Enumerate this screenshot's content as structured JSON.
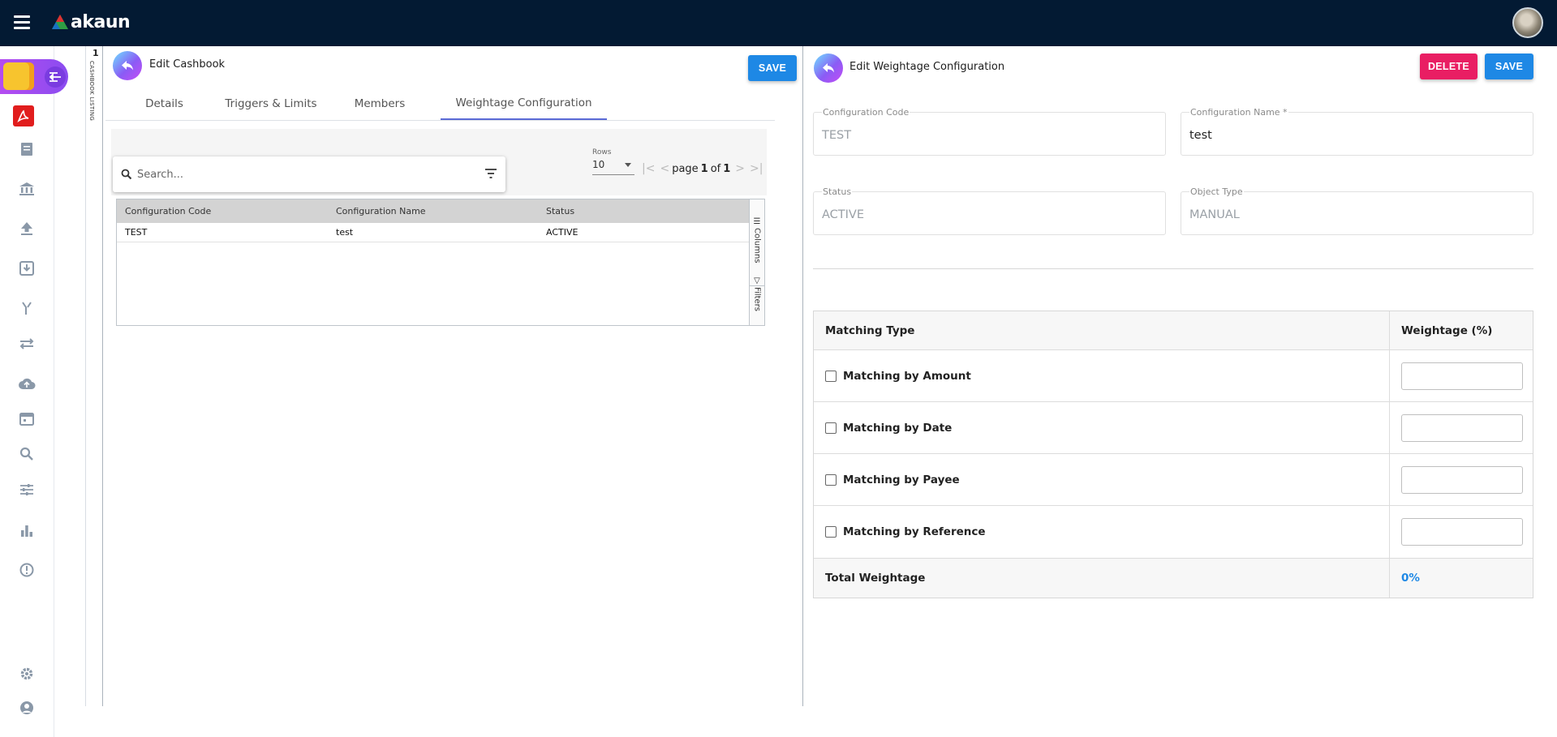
{
  "app": {
    "logo_text": "akaun"
  },
  "sidebar": {
    "icons": [
      "wallet-icon",
      "menu-collapse-icon",
      "acrobat-icon",
      "ledger-icon",
      "bank-icon",
      "upload-icon",
      "download-icon",
      "split-icon",
      "transfer-icon",
      "cloud-upload-icon",
      "calendar-icon",
      "search-icon",
      "sliders-icon",
      "bar-chart-icon",
      "alert-icon",
      "gear-icon",
      "user-icon"
    ]
  },
  "listing": {
    "count": "1",
    "label": "CASHBOOK LISTING"
  },
  "left_panel": {
    "title": "Edit Cashbook",
    "save_label": "SAVE",
    "tabs": [
      {
        "label": "Details"
      },
      {
        "label": "Triggers & Limits"
      },
      {
        "label": "Members"
      },
      {
        "label": "Weightage Configuration"
      }
    ],
    "search": {
      "placeholder": "Search..."
    },
    "pagination": {
      "rows_label": "Rows",
      "rows_value": "10",
      "page_word": "page",
      "page": "1",
      "of_word": "of",
      "total_pages": "1"
    },
    "table": {
      "columns": [
        "Configuration Code",
        "Configuration Name",
        "Status"
      ],
      "rows": [
        [
          "TEST",
          "test",
          "ACTIVE"
        ]
      ],
      "side_tools": [
        "Columns",
        "Filters"
      ]
    }
  },
  "right_panel": {
    "title": "Edit Weightage Configuration",
    "delete_label": "DELETE",
    "save_label": "SAVE",
    "fields": {
      "config_code": {
        "label": "Configuration Code",
        "value": "TEST"
      },
      "config_name": {
        "label": "Configuration Name *",
        "value": "test"
      },
      "status": {
        "label": "Status",
        "value": "ACTIVE"
      },
      "object_type": {
        "label": "Object Type",
        "value": "MANUAL"
      }
    },
    "weightage_table": {
      "header_type": "Matching Type",
      "header_weight": "Weightage (%)",
      "rows": [
        {
          "label": "Matching by Amount",
          "checked": false,
          "value": ""
        },
        {
          "label": "Matching by Date",
          "checked": false,
          "value": ""
        },
        {
          "label": "Matching by Payee",
          "checked": false,
          "value": ""
        },
        {
          "label": "Matching by Reference",
          "checked": false,
          "value": ""
        }
      ],
      "total_label": "Total Weightage",
      "total_value": "0%"
    }
  },
  "colors": {
    "topbar": "#031a33",
    "primary": "#1e88e5",
    "danger": "#e91e63",
    "tab_accent": "#5b6bd6"
  }
}
